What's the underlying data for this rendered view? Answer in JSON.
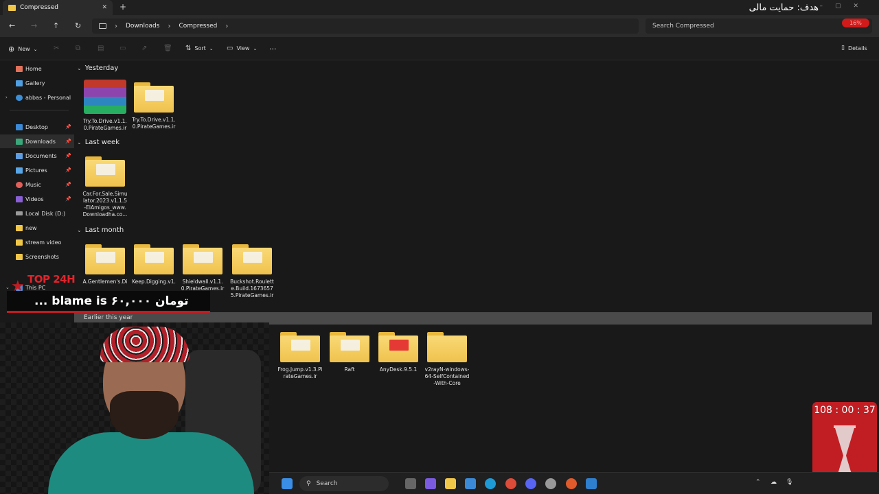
{
  "window": {
    "tab_title": "Compressed",
    "goal_text": "هدف: حمایت مالی",
    "progress_badge": "16%"
  },
  "address": {
    "crumbs": [
      "Downloads",
      "Compressed"
    ],
    "search_placeholder": "Search Compressed"
  },
  "toolbar": {
    "new_label": "New",
    "sort_label": "Sort",
    "view_label": "View",
    "more_label": "···",
    "details_label": "Details"
  },
  "sidebar": {
    "items": [
      {
        "label": "Home",
        "icon": "home-icon"
      },
      {
        "label": "Gallery",
        "icon": "gallery-icon"
      },
      {
        "label": "abbas - Personal",
        "icon": "cloud-icon"
      },
      {
        "label": "Desktop",
        "icon": "desktop-icon"
      },
      {
        "label": "Downloads",
        "icon": "download-icon"
      },
      {
        "label": "Documents",
        "icon": "documents-icon"
      },
      {
        "label": "Pictures",
        "icon": "pictures-icon"
      },
      {
        "label": "Music",
        "icon": "music-icon"
      },
      {
        "label": "Videos",
        "icon": "videos-icon"
      },
      {
        "label": "Local Disk (D:)",
        "icon": "drive-icon"
      },
      {
        "label": "new",
        "icon": "folder-icon"
      },
      {
        "label": "stream video",
        "icon": "folder-icon"
      },
      {
        "label": "Screenshots",
        "icon": "folder-icon"
      },
      {
        "label": "This PC",
        "icon": "pc-icon"
      }
    ]
  },
  "groups": {
    "yesterday": {
      "title": "Yesterday",
      "items": [
        "Try.To.Drive.v1.1.0.PirateGames.ir",
        "Try.To.Drive.v1.1.0.PirateGames.ir"
      ]
    },
    "last_week": {
      "title": "Last week",
      "items": [
        "Car.For.Sale.Simulator.2023.v1.1.5-ElAmigos_www.Downloadha.co..."
      ]
    },
    "last_month": {
      "title": "Last month",
      "items": [
        "A.Gentlemen's.Di",
        "Keep.Digging.v1.",
        "Shieldwall.v1.1.0.PirateGames.ir",
        "Buckshot.Roulette.Build.16736575.PirateGames.ir"
      ]
    },
    "earlier": {
      "title": "Earlier this year",
      "items": [
        "Frog.Jump.v1.3.PirateGames.ir",
        "Raft",
        "AnyDesk.9.5.1",
        "v2rayN-windows-64-SelfContained-With-Core"
      ]
    }
  },
  "overlay": {
    "top_logo": "TOP 24H",
    "ticker": "... blame is  ۶۰,۰۰۰ تومان",
    "timer": "108 : 00 : 37"
  },
  "taskbar": {
    "search_label": "Search"
  }
}
